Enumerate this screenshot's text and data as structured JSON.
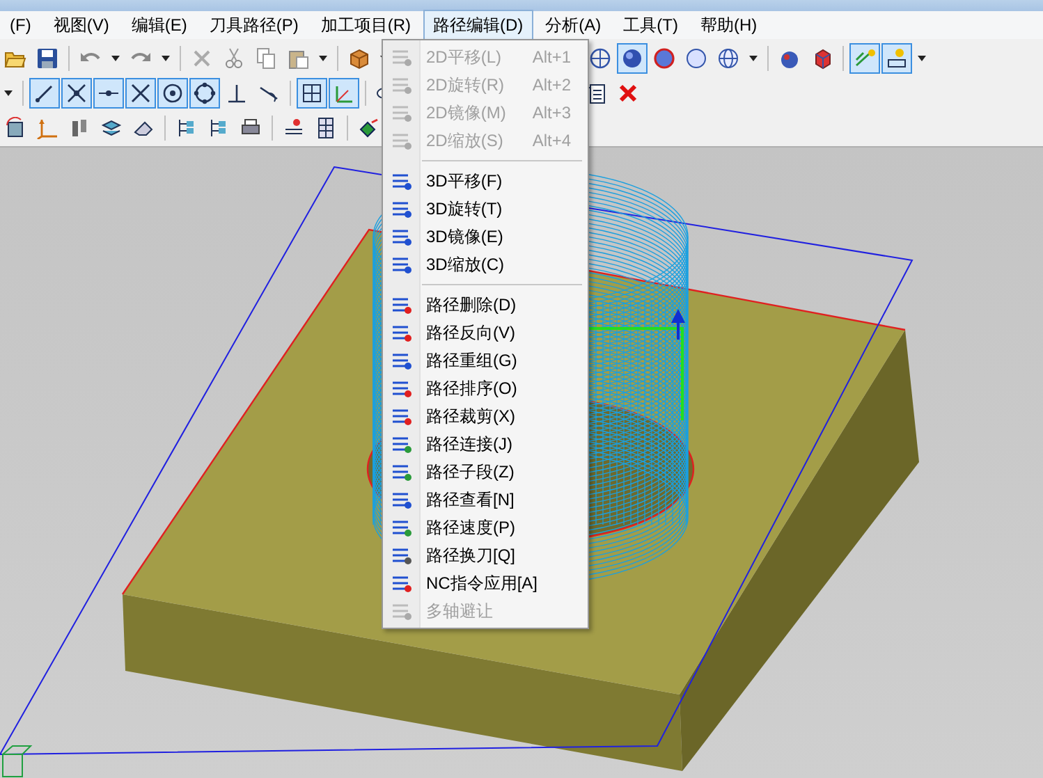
{
  "menubar": [
    {
      "label": "(F)",
      "selected": false
    },
    {
      "label": "视图(V)",
      "selected": false
    },
    {
      "label": "编辑(E)",
      "selected": false
    },
    {
      "label": "刀具路径(P)",
      "selected": false
    },
    {
      "label": "加工项目(R)",
      "selected": false
    },
    {
      "label": "路径编辑(D)",
      "selected": true
    },
    {
      "label": "分析(A)",
      "selected": false
    },
    {
      "label": "工具(T)",
      "selected": false
    },
    {
      "label": "帮助(H)",
      "selected": false
    }
  ],
  "toolbars": [
    {
      "items": [
        {
          "kind": "button",
          "pressed": false
        },
        {
          "kind": "button",
          "pressed": false
        },
        {
          "kind": "separator"
        },
        {
          "kind": "button",
          "pressed": false
        },
        {
          "kind": "dropdown"
        },
        {
          "kind": "button",
          "pressed": false
        },
        {
          "kind": "dropdown"
        },
        {
          "kind": "separator"
        },
        {
          "kind": "button",
          "pressed": false
        },
        {
          "kind": "button",
          "pressed": false
        },
        {
          "kind": "button",
          "pressed": false
        },
        {
          "kind": "button",
          "pressed": false
        },
        {
          "kind": "dropdown"
        },
        {
          "kind": "separator"
        },
        {
          "kind": "button",
          "pressed": false
        },
        {
          "kind": "dropdown"
        },
        {
          "kind": "gap"
        },
        {
          "kind": "button",
          "pressed": false
        },
        {
          "kind": "button",
          "pressed": true
        },
        {
          "kind": "button",
          "pressed": false
        },
        {
          "kind": "button",
          "pressed": false
        },
        {
          "kind": "button",
          "pressed": false
        },
        {
          "kind": "dropdown"
        },
        {
          "kind": "separator"
        },
        {
          "kind": "button",
          "pressed": false
        },
        {
          "kind": "button",
          "pressed": false
        },
        {
          "kind": "separator"
        },
        {
          "kind": "button",
          "pressed": true
        },
        {
          "kind": "button",
          "pressed": true
        },
        {
          "kind": "dropdown"
        }
      ]
    },
    {
      "items": [
        {
          "kind": "dropdown"
        },
        {
          "kind": "separator"
        },
        {
          "kind": "button",
          "pressed": true
        },
        {
          "kind": "button",
          "pressed": true
        },
        {
          "kind": "button",
          "pressed": true
        },
        {
          "kind": "button",
          "pressed": true
        },
        {
          "kind": "button",
          "pressed": true
        },
        {
          "kind": "button",
          "pressed": true
        },
        {
          "kind": "button",
          "pressed": false
        },
        {
          "kind": "button",
          "pressed": false
        },
        {
          "kind": "separator"
        },
        {
          "kind": "button",
          "pressed": true
        },
        {
          "kind": "button",
          "pressed": true
        },
        {
          "kind": "separator"
        },
        {
          "kind": "button",
          "pressed": false
        },
        {
          "kind": "gap"
        },
        {
          "kind": "button",
          "pressed": false
        },
        {
          "kind": "button",
          "pressed": false
        }
      ]
    },
    {
      "items": [
        {
          "kind": "button",
          "pressed": false
        },
        {
          "kind": "button",
          "pressed": false
        },
        {
          "kind": "button",
          "pressed": false
        },
        {
          "kind": "button",
          "pressed": false
        },
        {
          "kind": "button",
          "pressed": false
        },
        {
          "kind": "separator"
        },
        {
          "kind": "button",
          "pressed": false
        },
        {
          "kind": "button",
          "pressed": false
        },
        {
          "kind": "button",
          "pressed": false
        },
        {
          "kind": "separator"
        },
        {
          "kind": "button",
          "pressed": false
        },
        {
          "kind": "button",
          "pressed": false
        },
        {
          "kind": "separator"
        },
        {
          "kind": "button",
          "pressed": false
        }
      ]
    }
  ],
  "path_edit_menu": {
    "items": [
      {
        "kind": "item",
        "label": "2D平移(L)",
        "shortcut": "Alt+1",
        "disabled": true
      },
      {
        "kind": "item",
        "label": "2D旋转(R)",
        "shortcut": "Alt+2",
        "disabled": true
      },
      {
        "kind": "item",
        "label": "2D镜像(M)",
        "shortcut": "Alt+3",
        "disabled": true
      },
      {
        "kind": "item",
        "label": "2D缩放(S)",
        "shortcut": "Alt+4",
        "disabled": true
      },
      {
        "kind": "separator"
      },
      {
        "kind": "item",
        "label": "3D平移(F)",
        "disabled": false
      },
      {
        "kind": "item",
        "label": "3D旋转(T)",
        "disabled": false
      },
      {
        "kind": "item",
        "label": "3D镜像(E)",
        "disabled": false
      },
      {
        "kind": "item",
        "label": "3D缩放(C)",
        "disabled": false
      },
      {
        "kind": "separator"
      },
      {
        "kind": "item",
        "label": "路径删除(D)",
        "disabled": false
      },
      {
        "kind": "item",
        "label": "路径反向(V)",
        "disabled": false
      },
      {
        "kind": "item",
        "label": "路径重组(G)",
        "disabled": false
      },
      {
        "kind": "item",
        "label": "路径排序(O)",
        "disabled": false
      },
      {
        "kind": "item",
        "label": "路径裁剪(X)",
        "disabled": false
      },
      {
        "kind": "item",
        "label": "路径连接(J)",
        "disabled": false
      },
      {
        "kind": "item",
        "label": "路径子段(Z)",
        "disabled": false
      },
      {
        "kind": "item",
        "label": "路径查看[N]",
        "disabled": false
      },
      {
        "kind": "item",
        "label": "路径速度(P)",
        "disabled": false
      },
      {
        "kind": "item",
        "label": "路径换刀[Q]",
        "disabled": false
      },
      {
        "kind": "item",
        "label": "NC指令应用[A]",
        "disabled": false
      },
      {
        "kind": "item",
        "label": "多轴避让",
        "disabled": true
      }
    ]
  }
}
